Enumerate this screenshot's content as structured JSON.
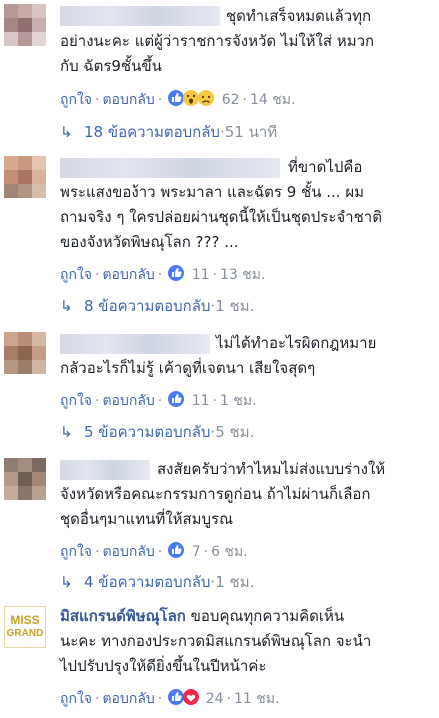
{
  "colors": {
    "link": "#4267b2",
    "meta": "#898f9c",
    "text": "#1d2129",
    "like_blue": "#4a7bf0",
    "love_red": "#f0284a",
    "haha_yellow": "#f7c844",
    "logo_gold": "#c9a227"
  },
  "labels": {
    "like": "ถูกใจ",
    "reply": "ตอบกลับ",
    "dot": "·"
  },
  "comments": [
    {
      "lines": [
        "ชุดทำเสร็จหมดแล้วทุก",
        "อย่างนะคะ แต่ผู้ว่าราชการจังหวัด ไม่ให้ใส่ หมวก",
        "กับ ฉัตร9ชั้นขึ้น"
      ],
      "reactions": [
        "like-icon",
        "wow-icon",
        "sad-icon"
      ],
      "reaction_count": "62",
      "time": "14 ชม.",
      "reply_count": "18 ข้อความตอบกลับ",
      "reply_time": "51 นาที"
    },
    {
      "lines": [
        "ที่ขาดไปคือ",
        "พระแสงของ้าว พระมาลา และฉัตร 9 ชั้น ... ผม",
        "ถามจริง ๆ ใครปล่อยผ่านชุดนี้ให้เป็นชุดประจำชาติ",
        "ของจังหวัดพิษณุโลก ??? ..."
      ],
      "reactions": [
        "like-icon"
      ],
      "reaction_count": "11",
      "time": "13 ชม.",
      "reply_count": "8 ข้อความตอบกลับ",
      "reply_time": "1 ชม."
    },
    {
      "lines": [
        "ไม่ได้ทำอะไรผิดกฎหมาย",
        "กลัวอะไรก็ไม่รู้ เค้าดูที่เจตนา เสียใจสุดๆ"
      ],
      "reactions": [
        "like-icon"
      ],
      "reaction_count": "11",
      "time": "1 ชม.",
      "reply_count": "5 ข้อความตอบกลับ",
      "reply_time": "5 ชม."
    },
    {
      "lines": [
        "สงสัยครับว่าทำไหมไม่ส่งแบบร่างให้",
        "จังหวัดหรือคณะกรรมการดูก่อน ถ้าไม่ผ่านก็เลือก",
        "ชุดอื่นๆมาแทนที่ให้สมบูรณ"
      ],
      "reactions": [
        "like-icon"
      ],
      "reaction_count": "7",
      "time": "6 ชม.",
      "reply_count": "4 ข้อความตอบกลับ",
      "reply_time": "1 ชม."
    }
  ],
  "page_comment": {
    "logo_line1": "MISS",
    "logo_line2": "GRAND",
    "name": "มิสแกรนด์พิษณุโลก",
    "lines": [
      "ขอบคุณทุกความคิดเห็น",
      "นะคะ ทางกองประกวดมิสแกรนด์พิษณุโลก จะนำ",
      "ไปปรับปรุงให้ดียิ่งขึ้นในปีหน้าค่ะ"
    ],
    "reactions": [
      "like-icon",
      "love-icon"
    ],
    "reaction_count": "24",
    "time": "11 ชม."
  }
}
